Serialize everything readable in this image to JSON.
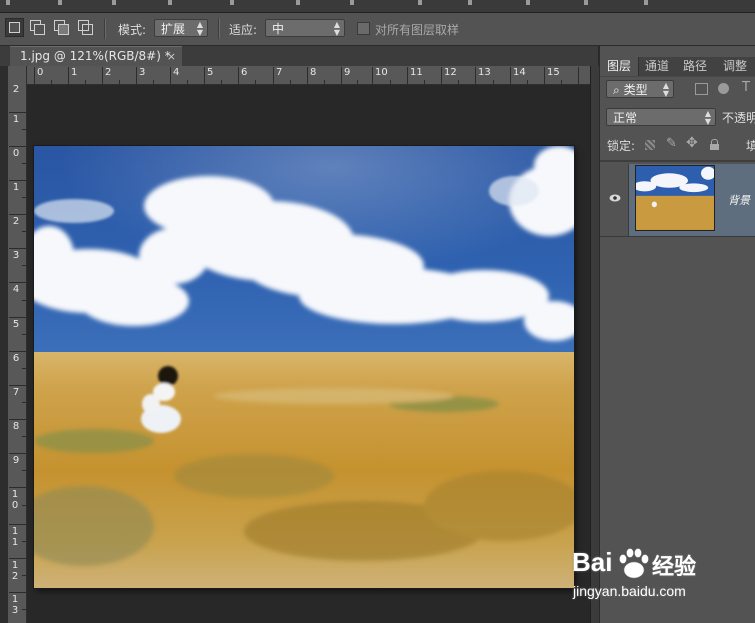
{
  "options_bar": {
    "mode_label": "模式:",
    "mode_value": "扩展",
    "adapt_label": "适应:",
    "adapt_value": "中",
    "sample_all_layers": "对所有图层取样"
  },
  "document": {
    "tab_title": "1.jpg @ 121%(RGB/8#) *",
    "close_glyph": "×"
  },
  "rulers": {
    "horizontal": [
      "0",
      "1",
      "2",
      "3",
      "4",
      "5",
      "6",
      "7",
      "8",
      "9",
      "10",
      "11",
      "12",
      "13",
      "14",
      "15"
    ],
    "vertical": [
      {
        "label": "2"
      },
      {
        "label": "1"
      },
      {
        "label": "0"
      },
      {
        "label": "1"
      },
      {
        "label": "2"
      },
      {
        "label": "3"
      },
      {
        "label": "4"
      },
      {
        "label": "5"
      },
      {
        "label": "6"
      },
      {
        "label": "7"
      },
      {
        "label": "8"
      },
      {
        "label": "9"
      },
      {
        "label": "1 0"
      },
      {
        "label": "1 1"
      },
      {
        "label": "1 2"
      },
      {
        "label": "1 3"
      }
    ]
  },
  "layers_panel": {
    "tabs": [
      "图层",
      "通道",
      "路径",
      "调整"
    ],
    "filter_kind": "类型",
    "blend_mode": "正常",
    "opacity_label": "不透明",
    "lock_label": "锁定:",
    "fill_label": "填",
    "layer_name": "背景"
  },
  "watermark": {
    "brand": "Bai",
    "brand_tail": "经验",
    "url": "jingyan.baidu.com"
  },
  "icons": [
    "rect-marquee-icon",
    "add-selection-icon",
    "subtract-selection-icon",
    "intersect-selection-icon",
    "eye-icon",
    "lock-icon",
    "brush-icon",
    "move-icon",
    "search-icon",
    "image-filter-icon",
    "circle-filter-icon",
    "text-filter-icon",
    "pattern-lock-icon",
    "paw-icon"
  ],
  "colors": {
    "ui_dark": "#282828",
    "ui_mid": "#535353",
    "layer_highlight": "#5f6e7e",
    "sky": "#2f5fa8",
    "wheat": "#c99a3a"
  }
}
